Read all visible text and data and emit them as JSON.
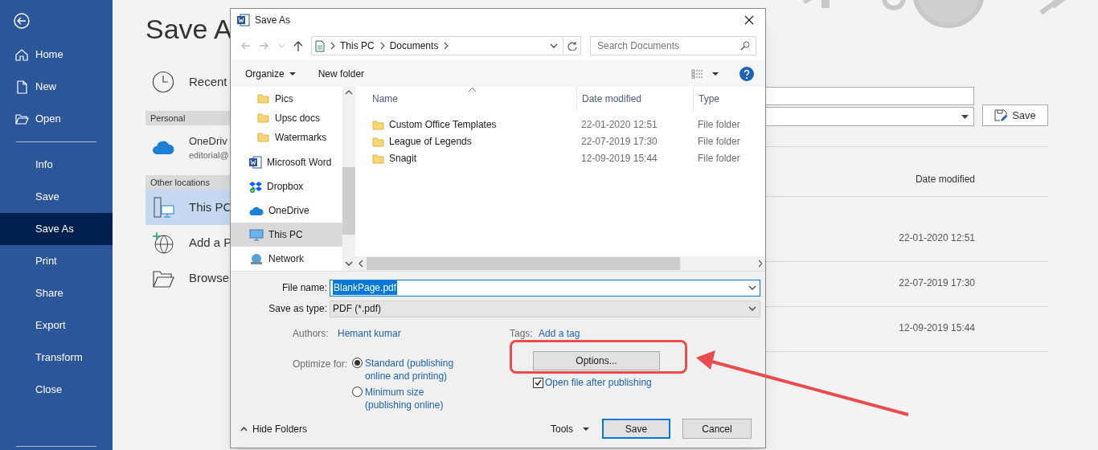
{
  "sidebar": {
    "top_items": [
      {
        "label": "Home"
      },
      {
        "label": "New"
      },
      {
        "label": "Open"
      }
    ],
    "items": [
      {
        "label": "Info",
        "selected": false
      },
      {
        "label": "Save",
        "selected": false
      },
      {
        "label": "Save As",
        "selected": true
      },
      {
        "label": "Print",
        "selected": false
      },
      {
        "label": "Share",
        "selected": false
      },
      {
        "label": "Export",
        "selected": false
      },
      {
        "label": "Transform",
        "selected": false
      },
      {
        "label": "Close",
        "selected": false
      }
    ]
  },
  "backstage": {
    "title": "Save A",
    "locations": [
      {
        "kind": "item",
        "label": "Recent",
        "selected": false
      },
      {
        "kind": "header",
        "label": "Personal"
      },
      {
        "kind": "account",
        "label": "OneDriv",
        "sublabel": "editorial@",
        "selected": false
      },
      {
        "kind": "header",
        "label": "Other locations"
      },
      {
        "kind": "item",
        "label": "This PC",
        "selected": true
      },
      {
        "kind": "item",
        "label": "Add a P",
        "selected": false
      },
      {
        "kind": "item",
        "label": "Browse",
        "selected": false
      }
    ],
    "save_button": "Save",
    "column": "Date modified",
    "rows": [
      {
        "date": "22-01-2020 12:51"
      },
      {
        "date": "22-07-2019 17:30"
      },
      {
        "date": "12-09-2019 15:44"
      }
    ]
  },
  "dialog": {
    "title": "Save As",
    "address": [
      "This PC",
      "Documents"
    ],
    "search": {
      "placeholder": "Search Documents"
    },
    "toolbar": {
      "organize": "Organize",
      "new_folder": "New folder"
    },
    "nav_pane": [
      {
        "label": "Pics",
        "kind": "folder",
        "selected": false
      },
      {
        "label": "Upsc docs",
        "kind": "folder",
        "selected": false
      },
      {
        "label": "Watermarks",
        "kind": "folder",
        "selected": false
      },
      {
        "label": "Microsoft Word",
        "kind": "word",
        "selected": false
      },
      {
        "label": "Dropbox",
        "kind": "dropbox",
        "selected": false
      },
      {
        "label": "OneDrive",
        "kind": "onedrive",
        "selected": false
      },
      {
        "label": "This PC",
        "kind": "pc",
        "selected": true
      },
      {
        "label": "Network",
        "kind": "network",
        "selected": false
      }
    ],
    "columns": [
      "Name",
      "Date modified",
      "Type"
    ],
    "rows": [
      {
        "name": "Custom Office Templates",
        "date": "22-01-2020 12:51",
        "type": "File folder"
      },
      {
        "name": "League of Legends",
        "date": "22-07-2019 17:30",
        "type": "File folder"
      },
      {
        "name": "Snagit",
        "date": "12-09-2019 15:44",
        "type": "File folder"
      }
    ],
    "file_name": {
      "label": "File name:",
      "value": "BlankPage.pdf"
    },
    "save_as_type": {
      "label": "Save as type:",
      "value": "PDF (*.pdf)"
    },
    "authors": {
      "label": "Authors:",
      "value": "Hemant kumar"
    },
    "tags": {
      "label": "Tags:",
      "value": "Add a tag"
    },
    "optimize": {
      "label": "Optimize for:",
      "options": [
        {
          "label": "Standard (publishing online and printing)",
          "selected": true
        },
        {
          "label": "Minimum size (publishing online)",
          "selected": false
        }
      ]
    },
    "options_button": "Options...",
    "open_after": {
      "label": "Open file after publishing",
      "checked": true
    },
    "hide_folders": "Hide Folders",
    "tools": "Tools",
    "save": "Save",
    "cancel": "Cancel"
  }
}
